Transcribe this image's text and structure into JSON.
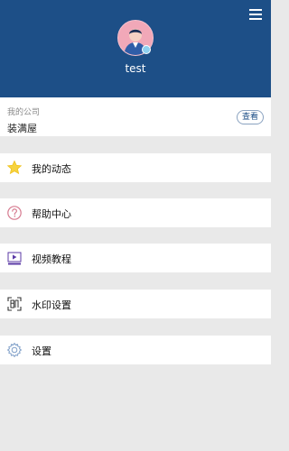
{
  "header": {
    "username": "test",
    "menu_icon": "hamburger-menu-icon",
    "avatar_icon": "user-avatar-icon",
    "colors": {
      "header_bg": "#1d4f87",
      "avatar_bg": "#f1a8b8"
    }
  },
  "company": {
    "label": "我的公司",
    "name": "装满屋",
    "view_button": "查看"
  },
  "menu": [
    {
      "label": "我的动态",
      "icon": "star-icon"
    },
    {
      "label": "帮助中心",
      "icon": "help-question-icon"
    },
    {
      "label": "视频教程",
      "icon": "video-play-icon"
    },
    {
      "label": "水印设置",
      "icon": "watermark-icon"
    },
    {
      "label": "设置",
      "icon": "settings-gear-icon"
    }
  ]
}
